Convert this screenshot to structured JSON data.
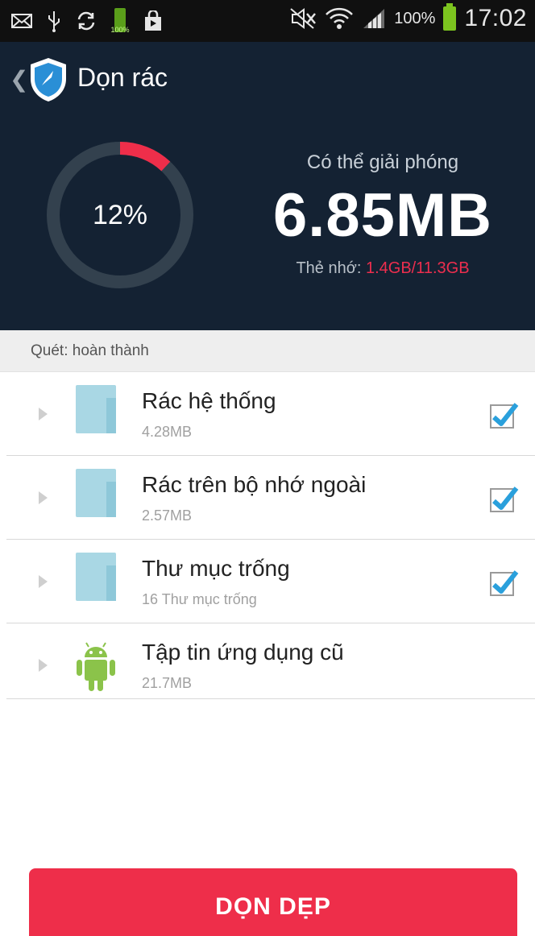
{
  "status_bar": {
    "icons": [
      "mail-icon",
      "usb-icon",
      "sync-icon",
      "battery-small-icon",
      "shopping-bag-icon",
      "mute-icon",
      "wifi-icon",
      "signal-icon"
    ],
    "battery_small": "100%",
    "battery_percent": "100%",
    "time": "17:02"
  },
  "header": {
    "title": "Dọn rác",
    "progress_percent": "12%",
    "progress_value": 0.12,
    "can_free_label": "Có thể giải phóng",
    "can_free_size": "6.85MB",
    "memory_label": "Thẻ nhớ: ",
    "memory_value": "1.4GB/11.3GB"
  },
  "scan": {
    "status": "Quét: hoàn thành"
  },
  "items": [
    {
      "title": "Rác hệ thống",
      "subtitle": "4.28MB",
      "icon": "folder-icon",
      "checked": true
    },
    {
      "title": "Rác trên bộ nhớ ngoài",
      "subtitle": "2.57MB",
      "icon": "folder-icon",
      "checked": true
    },
    {
      "title": "Thư mục trống",
      "subtitle": "16 Thư mục trống",
      "icon": "folder-icon",
      "checked": true
    },
    {
      "title": "Tập tin ứng dụng cũ",
      "subtitle": "21.7MB",
      "icon": "android-icon",
      "checked": false
    }
  ],
  "action": {
    "label": "DỌN DẸP"
  },
  "colors": {
    "header_bg": "#142233",
    "accent": "#ee2e4a",
    "ring_track": "#33414e",
    "checkbox_check": "#2aa0dc"
  }
}
